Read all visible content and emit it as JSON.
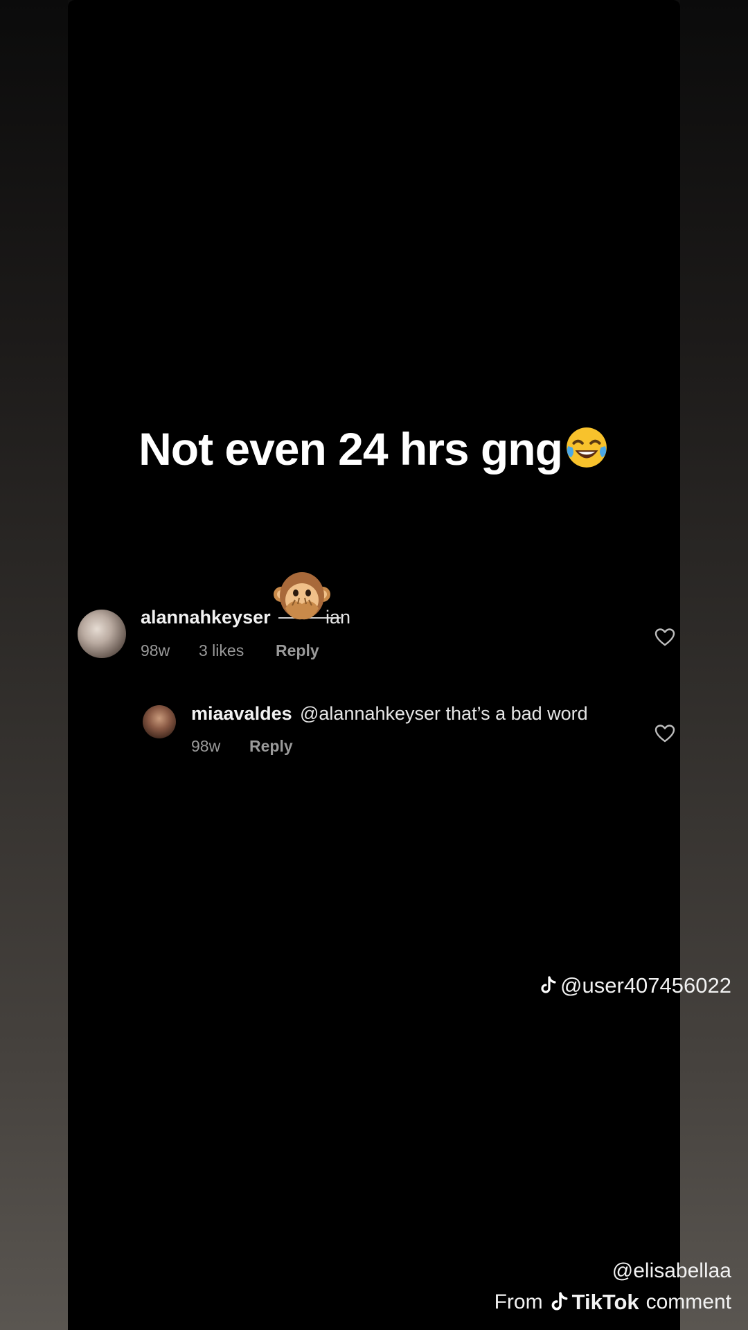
{
  "caption": "Not even 24 hrs gng",
  "caption_emoji": "face-with-tears-of-joy",
  "comments": [
    {
      "username": "alannahkeyser",
      "text_visible": "ian",
      "censor_emoji": "speak-no-evil-monkey",
      "age": "98w",
      "likes": "3 likes",
      "reply_label": "Reply"
    },
    {
      "username": "miaavaldes",
      "text": "@alannahkeyser that’s a bad word",
      "age": "98w",
      "reply_label": "Reply"
    }
  ],
  "watermark": "@user407456022",
  "credit": "@elisabellaa",
  "from_label": "From",
  "brand": "TikTok",
  "comment_label": "comment",
  "colors": {
    "panel": "#000000",
    "text": "#ffffff",
    "meta": "#9a9a9a"
  }
}
